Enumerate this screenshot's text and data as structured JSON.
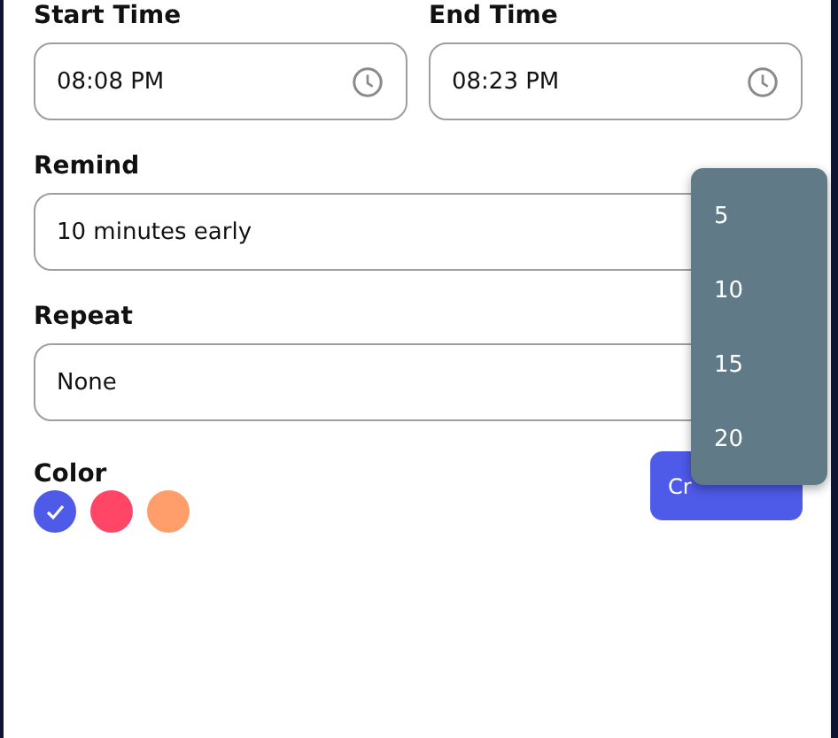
{
  "time_fields": [
    {
      "label": "Start Time",
      "value": "08:08 PM"
    },
    {
      "label": "End Time",
      "value": "08:23 PM"
    }
  ],
  "remind": {
    "label": "Remind",
    "value": "10 minutes early"
  },
  "repeat": {
    "label": "Repeat",
    "value": "None"
  },
  "color": {
    "label": "Color",
    "swatches": [
      {
        "color": "#4e5ae8",
        "selected": true
      },
      {
        "color": "#ff4667",
        "selected": false
      },
      {
        "color": "#ff9d6b",
        "selected": false
      }
    ]
  },
  "create_button": {
    "label": "Cr"
  },
  "remind_menu": {
    "options": [
      "5",
      "10",
      "15",
      "20"
    ]
  }
}
